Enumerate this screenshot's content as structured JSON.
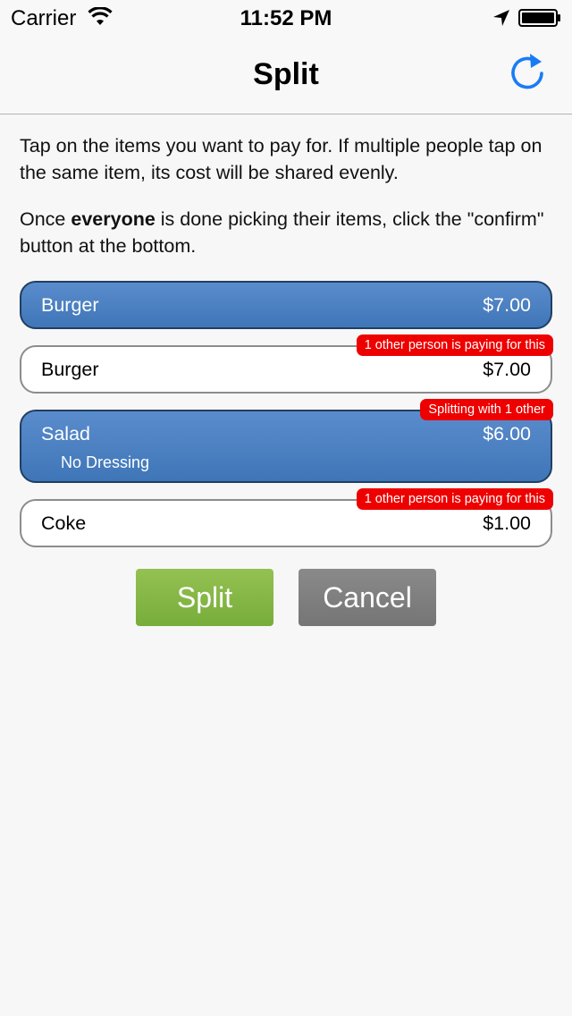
{
  "status_bar": {
    "carrier": "Carrier",
    "time": "11:52 PM"
  },
  "nav": {
    "title": "Split",
    "refresh_icon": "refresh-icon",
    "accent_color": "#1a7cf5"
  },
  "instructions": {
    "p1": "Tap on the items you want to pay for. If multiple people tap on the same item, its cost will be shared evenly.",
    "p2_prefix": "Once ",
    "p2_bold": "everyone",
    "p2_suffix": " is done picking their items, click the \"confirm\" button at the bottom."
  },
  "items": [
    {
      "name": "Burger",
      "price": "$7.00",
      "selected": true,
      "note": "",
      "badge": ""
    },
    {
      "name": "Burger",
      "price": "$7.00",
      "selected": false,
      "note": "",
      "badge": "1 other person is paying for this"
    },
    {
      "name": "Salad",
      "price": "$6.00",
      "selected": true,
      "note": "No Dressing",
      "badge": "Splitting with 1 other"
    },
    {
      "name": "Coke",
      "price": "$1.00",
      "selected": false,
      "note": "",
      "badge": "1 other person is paying for this"
    }
  ],
  "buttons": {
    "split": "Split",
    "cancel": "Cancel"
  },
  "colors": {
    "selected_item": "#4a80c2",
    "badge": "#ee0000",
    "split_button": "#84b548",
    "cancel_button": "#808080"
  }
}
